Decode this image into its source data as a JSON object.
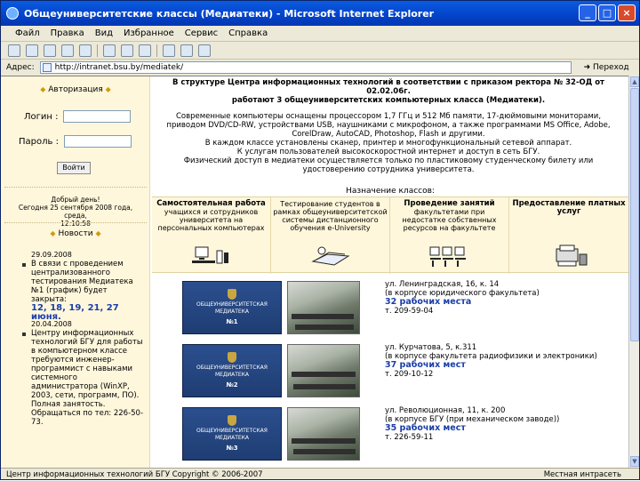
{
  "window": {
    "title": "Общеуниверситетские классы (Медиатеки) - Microsoft Internet Explorer",
    "controls": [
      "_",
      "□",
      "×"
    ]
  },
  "menu": [
    "Файл",
    "Правка",
    "Вид",
    "Избранное",
    "Сервис",
    "Справка"
  ],
  "toolbar": {
    "icons": [
      "back-icon",
      "forward-icon",
      "stop-icon",
      "refresh-icon",
      "home-icon",
      "search-icon",
      "favorites-icon",
      "history-icon",
      "mail-icon",
      "print-icon",
      "edit-icon"
    ]
  },
  "address": {
    "label": "Адрес:",
    "url": "http://intranet.bsu.by/mediatek/",
    "go_label": "Переход"
  },
  "left": {
    "auth_title": "Авторизация",
    "login_label": "Логин :",
    "password_label": "Пароль :",
    "login_button": "Войти",
    "greeting": [
      "Добрый день!",
      "Сегодня 25 сентября 2008 года, среда,",
      "12:10:58"
    ],
    "news_title": "Новости",
    "news": [
      {
        "date": "29.09.2008",
        "text": "В связи с проведением централизованного тестирования Медиатека №1 (график) будет закрыта:",
        "highlight": "12, 18, 19, 21, 27 июня."
      },
      {
        "date": "20.04.2008",
        "text": "Центру информационных технологий БГУ для работы в компьютерном классе требуются инженер-программист с навыками системного администратора (WinXP, 2003, сети, программ, ПО). Полная занятость. Обращаться по тел: 226-50-73."
      }
    ]
  },
  "intro": {
    "lines": [
      "В структуре Центра информационных технологий в соответствии с приказом ректора № 32-ОД от 02.02.06г.",
      "работают 3 общеуниверситетских компьютерных класса (Медиатеки)."
    ],
    "body": "Современные компьютеры оснащены процессором 1,7 ГГц и 512 Мб памяти, 17-дюймовыми мониторами, приводом DVD/CD-RW, устройствами USB, наушниками с микрофоном, а также программами MS Office, Adobe, CorelDraw, AutoCAD, Photoshop, Flash и другими.",
    "note1": "В каждом классе установлены сканер, принтер и многофункциональный сетевой аппарат.",
    "note2": "К услугам пользователей высокоскоростной интернет и доступ в сеть БГУ.",
    "note3": "Физический доступ в медиатеки осуществляется только по пластиковому студенческому билету или удостоверению сотрудника университета."
  },
  "purpose": {
    "title": "Назначение классов:",
    "cells": [
      {
        "title": "Самостоятельная работа",
        "text": "учащихся и сотрудников университета на персональных компьютерах",
        "icon": "workstation-icon"
      },
      {
        "title": "",
        "text": "Тестирование студентов в рамках общеуниверситетской системы дистанционного обучения e-University",
        "icon": "books-icon"
      },
      {
        "title": "Проведение занятий",
        "text": "факультетами при недостатке собственных ресурсов на факультете",
        "icon": "classroom-icon"
      },
      {
        "title": "Предоставление платных услуг",
        "text": "",
        "icon": "printer-icon"
      }
    ]
  },
  "labs": [
    {
      "logo_text": "ОБЩЕУНИВЕРСИТЕТСКАЯ МЕДИАТЕКА",
      "number": "№1",
      "address": "ул. Ленинградская, 16, к. 14",
      "location": "(в корпусе юридического факультета)",
      "seats": "32 рабочих места",
      "phone": "т. 209-59-04"
    },
    {
      "logo_text": "ОБЩЕУНИВЕРСИТЕТСКАЯ МЕДИАТЕКА",
      "number": "№2",
      "address": "ул. Курчатова, 5, к.311",
      "location": "(в корпусе факультета радиофизики и электроники)",
      "seats": "37 рабочих мест",
      "phone": "т. 209-10-12"
    },
    {
      "logo_text": "ОБЩЕУНИВЕРСИТЕТСКАЯ МЕДИАТЕКА",
      "number": "№3",
      "address": "ул. Революционная, 11, к. 200",
      "location": "(в корпусе БГУ (при механическом заводе))",
      "seats": "35 рабочих мест",
      "phone": "т. 226-59-11"
    }
  ],
  "status": {
    "text": "Центр информационных технологий БГУ Copyright © 2006-2007",
    "zone": "Местная интрасеть"
  }
}
